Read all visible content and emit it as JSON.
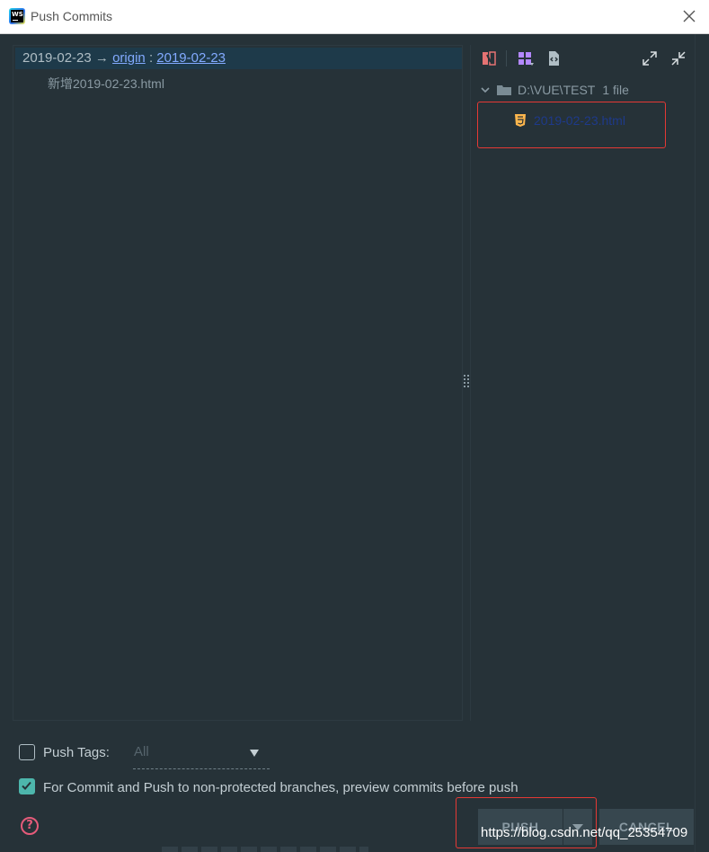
{
  "window": {
    "title": "Push Commits",
    "close_icon": "close-icon"
  },
  "commits": {
    "row": {
      "branch_local": "2019-02-23",
      "arrow": "→",
      "remote": "origin",
      "separator": ":",
      "branch_remote": "2019-02-23"
    },
    "file": "新增2019-02-23.html"
  },
  "changes": {
    "toolbar": [
      "diff-icon",
      "group-by-icon",
      "show-diff-icon",
      "expand-all-icon",
      "collapse-all-icon"
    ],
    "root": {
      "path": "D:\\VUE\\TEST",
      "count": "1 file"
    },
    "file": {
      "name": "2019-02-23.html",
      "icon": "html5-icon"
    }
  },
  "options": {
    "push_tags_label": "Push Tags:",
    "push_tags_value": "All",
    "preview_checked": true,
    "preview_label": "For Commit and Push to non-protected branches, preview commits before push"
  },
  "buttons": {
    "push": "PUSH",
    "cancel": "CANCEL"
  },
  "watermark": "https://blog.csdn.net/qq_25354709",
  "colors": {
    "background": "#263238",
    "accent": "#4db6ac",
    "link": "#82aaff",
    "highlight_box": "#e53935",
    "help": "#e55b7a"
  }
}
